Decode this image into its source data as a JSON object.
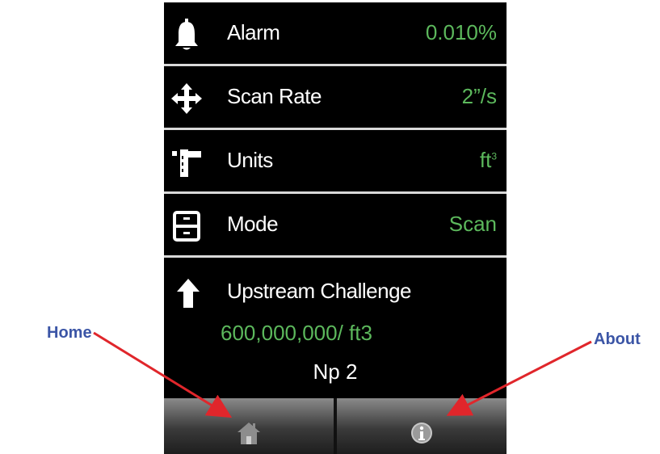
{
  "settings": [
    {
      "label": "Alarm",
      "value": "0.010%",
      "value_sup": "",
      "icon": "bell-icon"
    },
    {
      "label": "Scan Rate",
      "value": "2”/s",
      "value_sup": "",
      "icon": "move-arrows-icon"
    },
    {
      "label": "Units",
      "value": "ft",
      "value_sup": "3",
      "icon": "ruler-icon"
    },
    {
      "label": "Mode",
      "value": "Scan",
      "value_sup": "",
      "icon": "drawer-icon"
    }
  ],
  "challenge": {
    "title": "Upstream Challenge",
    "count": "600,000,000/ ft3",
    "np": "Np 2",
    "icon": "up-arrow-icon"
  },
  "footer": {
    "home_icon": "home-icon",
    "about_icon": "info-icon"
  },
  "callouts": {
    "home": "Home",
    "about": "About"
  },
  "colors": {
    "value_text": "#5cb85c",
    "callout_text": "#3b55a6",
    "arrow": "#e0262b",
    "screen_bg": "#000000"
  }
}
